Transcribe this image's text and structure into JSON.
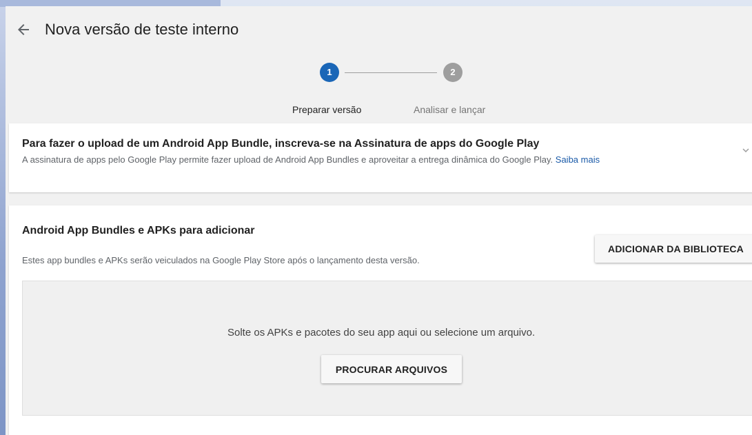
{
  "header": {
    "title": "Nova versão de teste interno",
    "back_icon": "arrow-left-icon"
  },
  "stepper": {
    "steps": [
      {
        "number": "1",
        "label": "Preparar versão",
        "active": true
      },
      {
        "number": "2",
        "label": "Analisar e lançar",
        "active": false
      }
    ],
    "active_color": "#1a66b7",
    "inactive_color": "#9e9e9e"
  },
  "signing_card": {
    "title": "Para fazer o upload de um Android App Bundle, inscreva-se na Assinatura de apps do Google Play",
    "description": "A assinatura de apps pelo Google Play permite fazer upload de Android App Bundles e aproveitar a entrega dinâmica do Google Play.",
    "link_label": "Saiba mais",
    "expand_icon": "chevron-down-icon"
  },
  "bundles_card": {
    "title": "Android App Bundles e APKs para adicionar",
    "description": "Estes app bundles e APKs serão veiculados na Google Play Store após o lançamento desta versão.",
    "library_button": "ADICIONAR DA BIBLIOTECA",
    "dropzone_text": "Solte os APKs e pacotes do seu app aqui ou selecione um arquivo.",
    "browse_button": "PROCURAR ARQUIVOS"
  },
  "colors": {
    "link": "#1a5aa8",
    "page_background": "#f1f1f1"
  }
}
